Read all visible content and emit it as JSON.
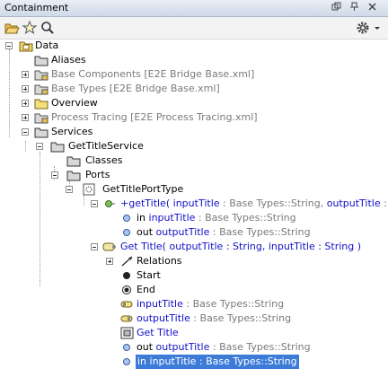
{
  "panel": {
    "title": "Containment"
  },
  "tree": {
    "data": "Data",
    "aliases": "Aliases",
    "base_components": "Base Components [E2E Bridge Base.xml]",
    "base_types": "Base Types [E2E Bridge Base.xml]",
    "overview": "Overview",
    "process_tracing": "Process Tracing [E2E Process Tracing.xml]",
    "services": "Services",
    "get_title_service": "GetTitleService",
    "classes": "Classes",
    "ports": "Ports",
    "get_title_port_type": "GetTitlePortType",
    "op_getTitle_prefix": "+getTitle( ",
    "op_in_name": "inputTitle",
    "op_in_type": " : Base Types::String, ",
    "op_out_name": "outputTitle",
    "op_out_type": " : Base T",
    "param_in_dir": "in ",
    "param_in_name": "inputTitle",
    "param_in_type": " : Base Types::String",
    "param_out_dir": "out ",
    "param_out_name": "outputTitle",
    "param_out_type": " : Base Types::String",
    "activity": "Get Title( outputTitle : String, inputTitle : String )",
    "relations": "Relations",
    "start": "Start",
    "end": "End",
    "pin_in_name": "inputTitle",
    "pin_in_type": " : Base Types::String",
    "pin_out_name": "outputTitle",
    "pin_out_type": " : Base Types::String",
    "action_get_title": "Get Title",
    "act_out_dir": "out ",
    "act_out_name": "outputTitle",
    "act_out_type": " : Base Types::String",
    "act_in_selected": "in inputTitle : Base Types::String"
  }
}
